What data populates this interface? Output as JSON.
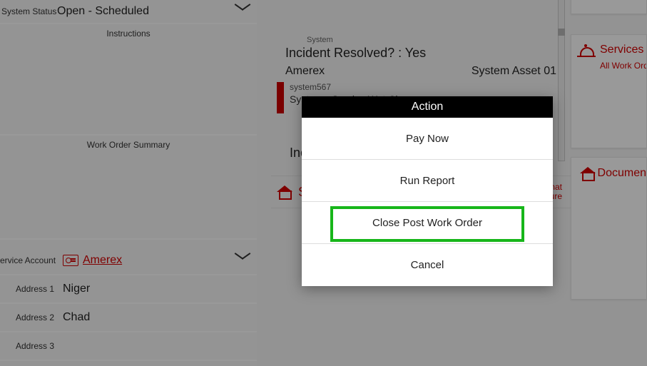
{
  "left": {
    "system_status_label": "System Status",
    "system_status_value": "Open - Scheduled",
    "instructions_header": "Instructions",
    "summary_header": "Work Order Summary",
    "service_account_label": "ervice Account",
    "service_account_value": "Amerex",
    "address1_label": "Address 1",
    "address1_value": "Niger",
    "address2_label": "Address 2",
    "address2_value": "Chad",
    "address3_label": "Address 3",
    "address3_value": ""
  },
  "mid": {
    "system_label": "System",
    "incident_resolved": "Incident Resolved? : Yes",
    "asset_left": "Amerex",
    "asset_right": "System Asset 01",
    "sub_code": "system567",
    "sub_desc": "System - Service Wet Chem",
    "inc_cut": "Inc",
    "svc_s": "S",
    "signat1": "gnat",
    "signat2": "ure"
  },
  "right": {
    "services_title": "Services",
    "services_sub": "All Work Orde",
    "documents_title": "Documen"
  },
  "modal": {
    "title": "Action",
    "options": [
      "Pay Now",
      "Run Report",
      "Close Post Work Order",
      "Cancel"
    ]
  }
}
